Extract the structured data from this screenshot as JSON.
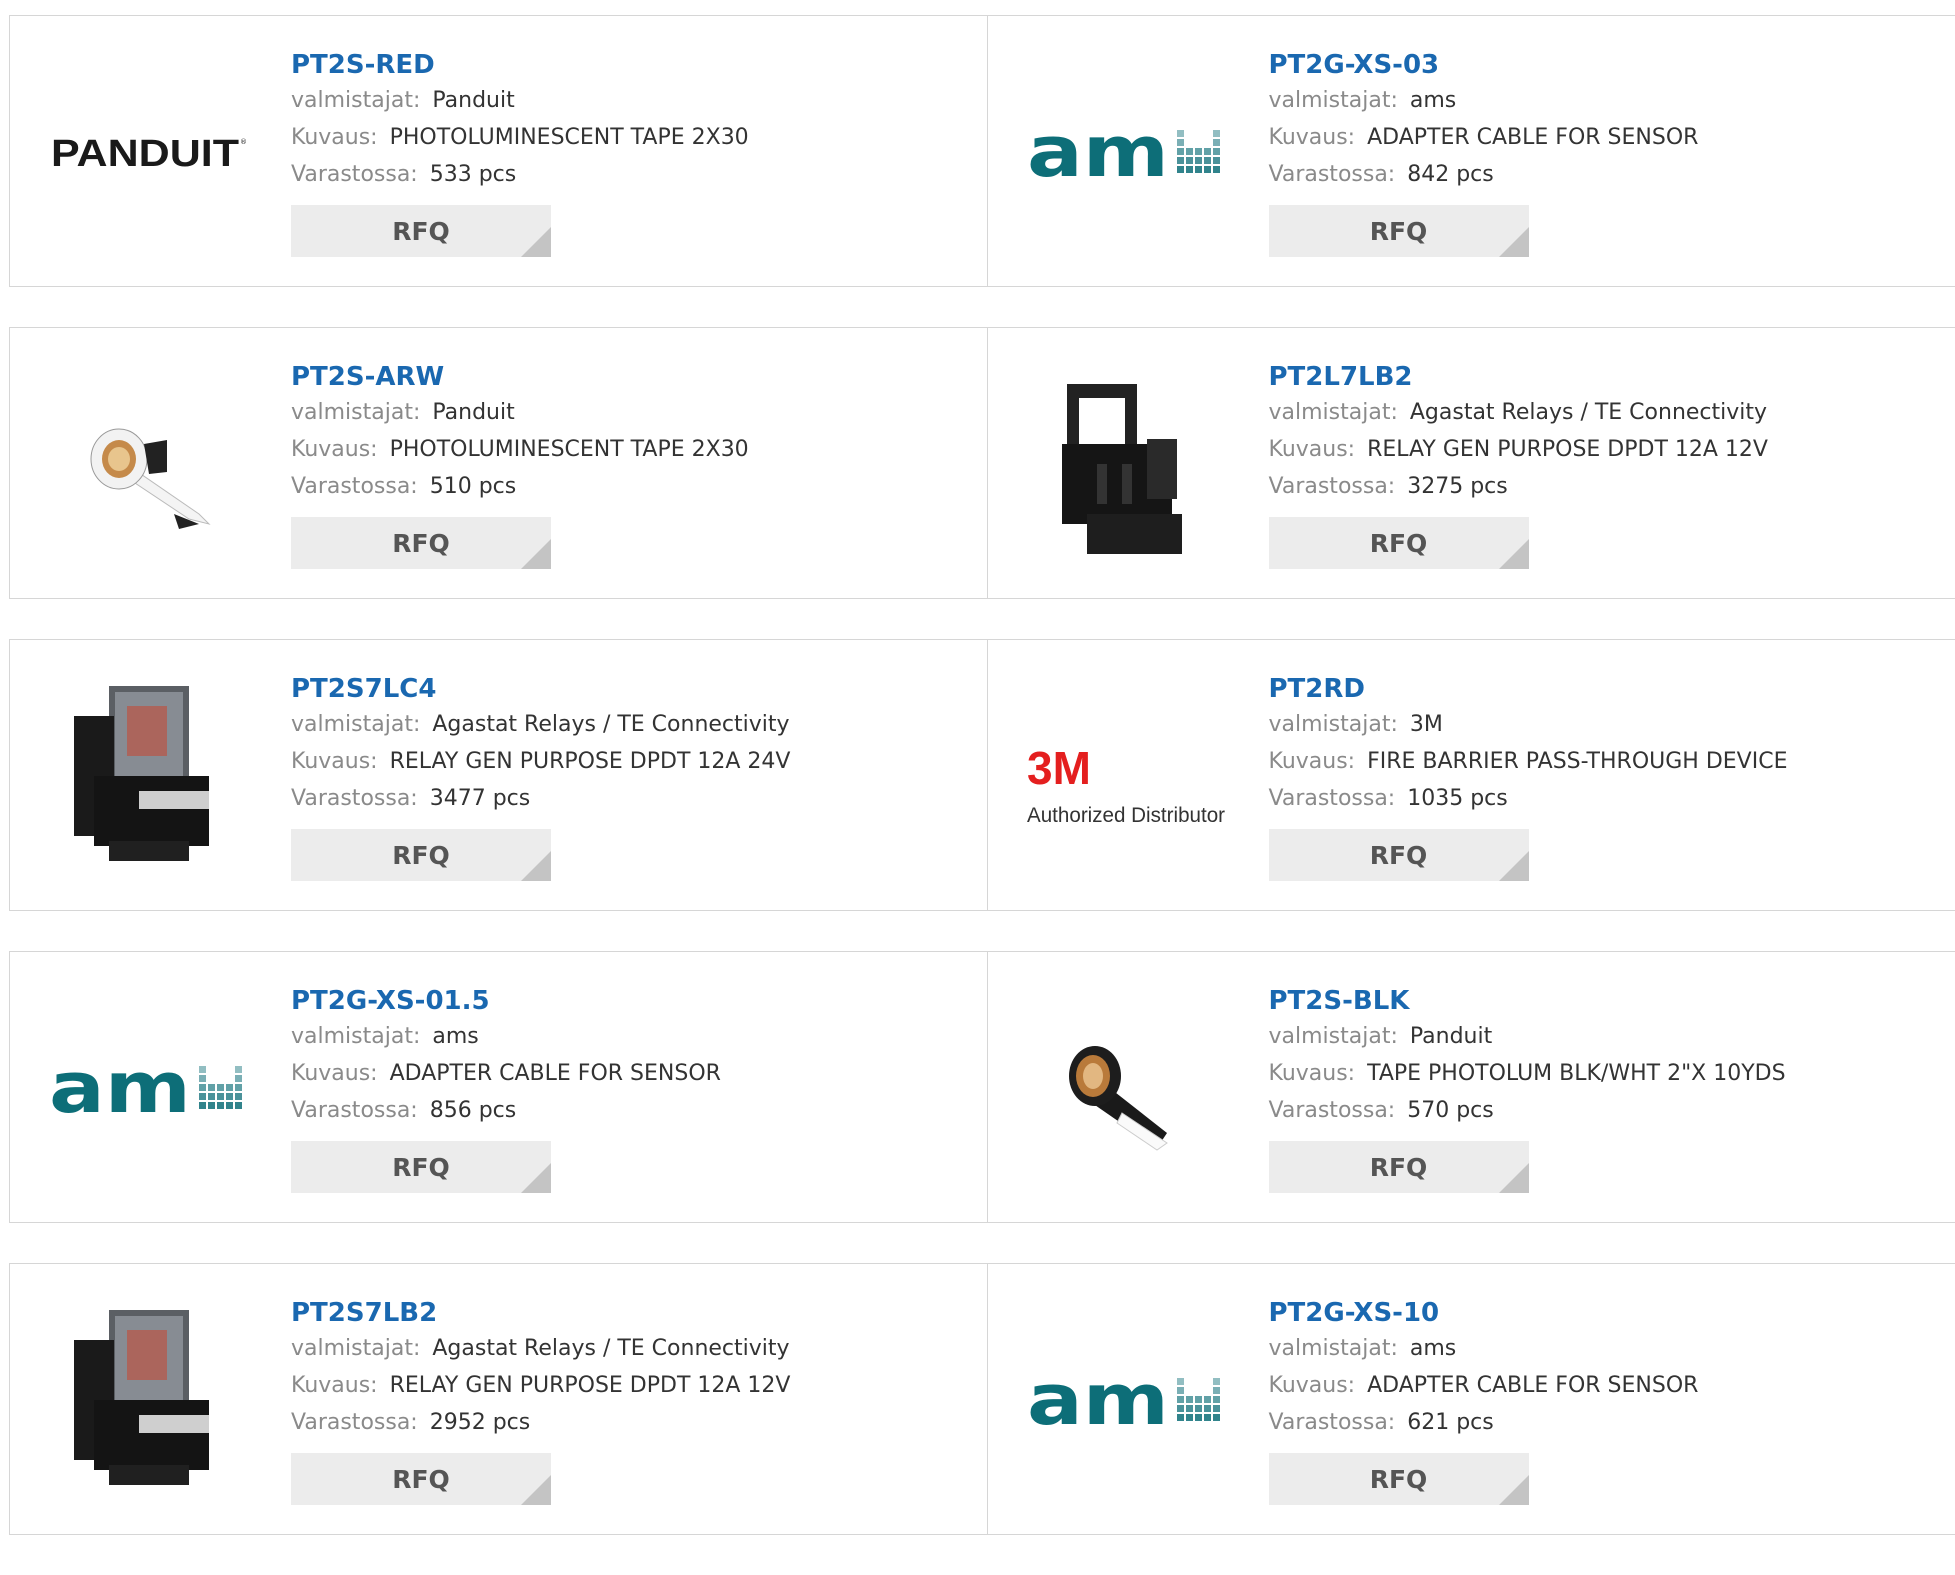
{
  "labels": {
    "manufacturer": "valmistajat:",
    "description": "Kuvaus:",
    "stock": "Varastossa:",
    "rfq": "RFQ"
  },
  "products": [
    {
      "pn": "PT2S-RED",
      "mfr": "Panduit",
      "desc": "PHOTOLUMINESCENT TAPE 2X30",
      "stock": "533 pcs",
      "image": "panduit-logo",
      "logo_text": "PANDUIT"
    },
    {
      "pn": "PT2G-XS-03",
      "mfr": "ams",
      "desc": "ADAPTER CABLE FOR SENSOR",
      "stock": "842 pcs",
      "image": "ams-logo",
      "logo_text": "am"
    },
    {
      "pn": "PT2S-ARW",
      "mfr": "Panduit",
      "desc": "PHOTOLUMINESCENT TAPE 2X30",
      "stock": "510 pcs",
      "image": "tape-roll-white",
      "logo_text": ""
    },
    {
      "pn": "PT2L7LB2",
      "mfr": "Agastat Relays / TE Connectivity",
      "desc": "RELAY GEN PURPOSE DPDT 12A 12V",
      "stock": "3275 pcs",
      "image": "relay-socket",
      "logo_text": ""
    },
    {
      "pn": "PT2S7LC4",
      "mfr": "Agastat Relays / TE Connectivity",
      "desc": "RELAY GEN PURPOSE DPDT 12A 24V",
      "stock": "3477 pcs",
      "image": "relay",
      "logo_text": ""
    },
    {
      "pn": "PT2RD",
      "mfr": "3M",
      "desc": "FIRE BARRIER PASS-THROUGH DEVICE",
      "stock": "1035 pcs",
      "image": "3m-logo",
      "logo_text": "3M",
      "logo_sub": "Authorized Distributor"
    },
    {
      "pn": "PT2G-XS-01.5",
      "mfr": "ams",
      "desc": "ADAPTER CABLE FOR SENSOR",
      "stock": "856 pcs",
      "image": "ams-logo",
      "logo_text": "am"
    },
    {
      "pn": "PT2S-BLK",
      "mfr": "Panduit",
      "desc": "TAPE PHOTOLUM BLK/WHT 2\"X 10YDS",
      "stock": "570 pcs",
      "image": "tape-roll-black",
      "logo_text": ""
    },
    {
      "pn": "PT2S7LB2",
      "mfr": "Agastat Relays / TE Connectivity",
      "desc": "RELAY GEN PURPOSE DPDT 12A 12V",
      "stock": "2952 pcs",
      "image": "relay",
      "logo_text": ""
    },
    {
      "pn": "PT2G-XS-10",
      "mfr": "ams",
      "desc": "ADAPTER CABLE FOR SENSOR",
      "stock": "621 pcs",
      "image": "ams-logo",
      "logo_text": "am"
    }
  ],
  "colors": {
    "link": "#1a68b0",
    "label": "#8a8a8a",
    "rfq_bg": "#ececec",
    "border": "#d6d6d6",
    "ams": "#0d6e78"
  }
}
